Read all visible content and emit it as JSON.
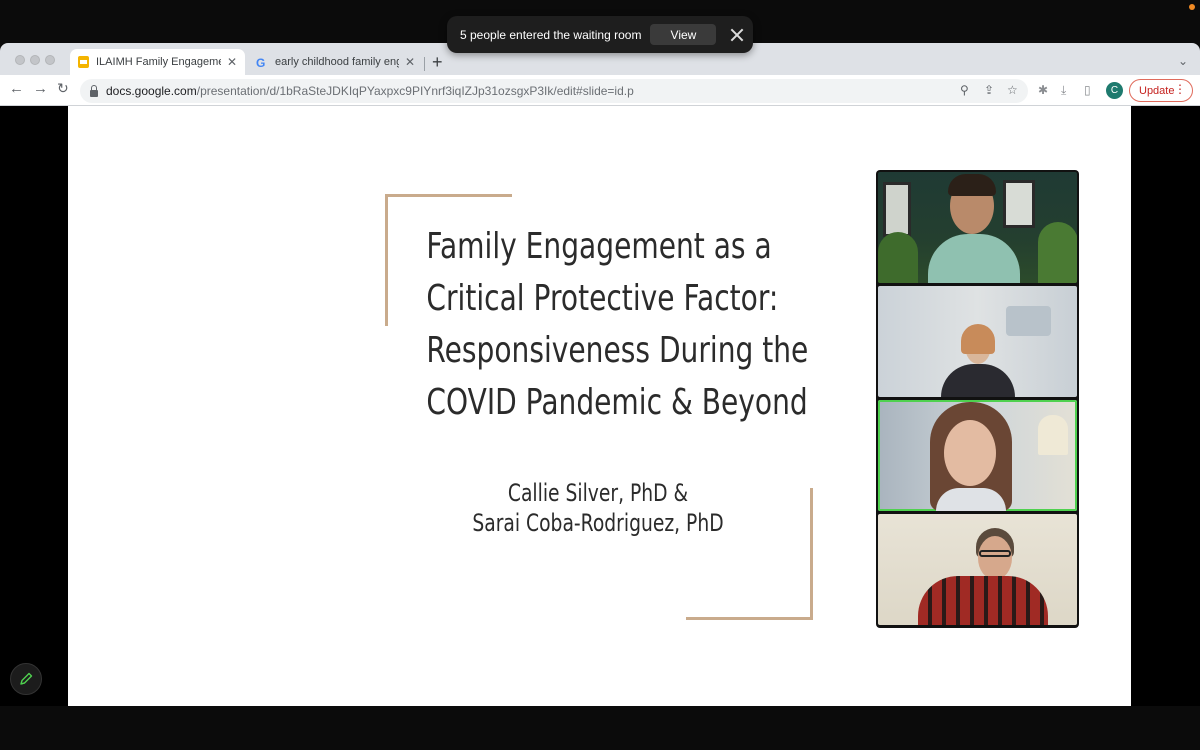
{
  "notification": {
    "message": "5 people entered the waiting room",
    "view_label": "View"
  },
  "browser": {
    "tabs": [
      {
        "title": "ILAIMH Family Engagement Se",
        "active": true
      },
      {
        "title": "early childhood family engagem",
        "active": false
      }
    ],
    "url_host": "docs.google.com",
    "url_path": "/presentation/d/1bRaSteJDKIqPYaxpxc9PIYnrf3iqIZJp31ozsgxP3Ik/edit#slide=id.p",
    "profile_initial": "C",
    "update_label": "Update"
  },
  "slide": {
    "title_lines": [
      "Family Engagement as a",
      "Critical Protective Factor:",
      "Responsiveness During the",
      "COVID Pandemic & Beyond"
    ],
    "author_lines": [
      "Callie Silver, PhD &",
      "Sarai Coba-Rodriguez, PhD"
    ]
  },
  "video_tiles": [
    {
      "id": "participant-1",
      "speaking": false
    },
    {
      "id": "participant-2",
      "speaking": false
    },
    {
      "id": "participant-3",
      "speaking": true
    },
    {
      "id": "participant-4",
      "speaking": false
    }
  ],
  "colors": {
    "frame_accent": "#c9ab8c",
    "speaking_border": "#4fd14f",
    "update_accent": "#c5221f"
  }
}
